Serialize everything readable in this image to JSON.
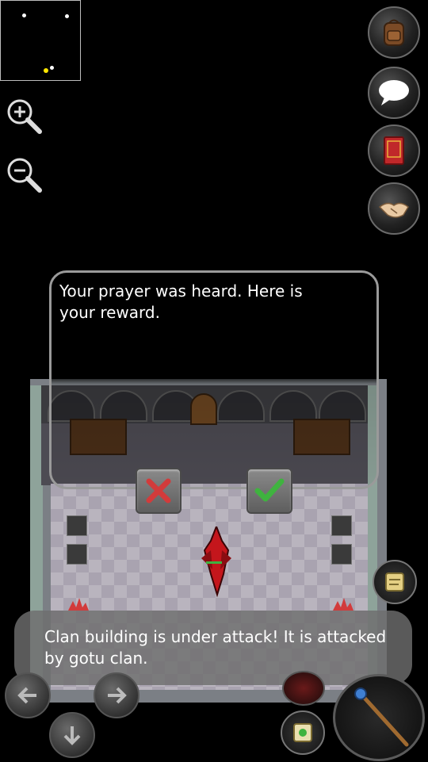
{
  "minimap": {
    "label": "minimap"
  },
  "controls": {
    "zoom_in": "zoom-in",
    "zoom_out": "zoom-out",
    "inventory": "backpack-icon",
    "chat": "speech-bubble-icon",
    "quests": "red-book-icon",
    "trade": "handshake-icon"
  },
  "dialog": {
    "message": "Your prayer was heard. Here is your reward.",
    "cancel": "✖",
    "confirm": "✔"
  },
  "toast": {
    "message": "Clan building is under attack! It is attacked by gotu clan."
  },
  "colors": {
    "accent_red": "#d23b3b",
    "accent_green": "#3fb33f",
    "dialog_border": "#9a9a9a"
  }
}
